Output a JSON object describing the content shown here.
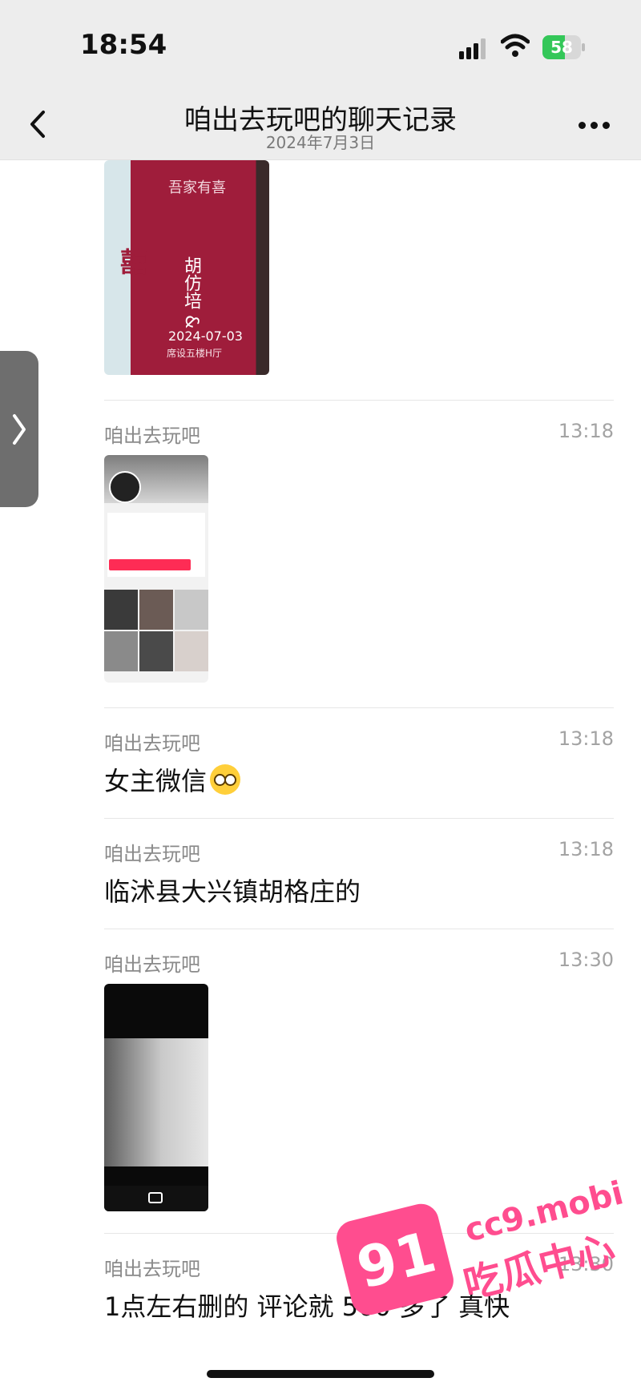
{
  "status_bar": {
    "time": "18:54",
    "battery_level": "58",
    "battery_fraction": 0.58,
    "battery_color": "#34c759"
  },
  "nav": {
    "title": "咱出去玩吧的聊天记录",
    "subtitle": "2024年7月3日",
    "back_icon": "chevron-left-icon",
    "more_icon": "ellipsis-icon"
  },
  "side_tab": {
    "icon": "chevron-right-icon"
  },
  "poster": {
    "xi": "囍",
    "title": "吾家有喜",
    "name": "胡仿培 &",
    "date": "2024-07-03",
    "venue": "席设五楼H厅"
  },
  "messages": [
    {
      "sender": "咱出去玩吧",
      "time": "13:18",
      "type": "image"
    },
    {
      "sender": "咱出去玩吧",
      "time": "13:18",
      "type": "text",
      "text": "女主微信"
    },
    {
      "sender": "咱出去玩吧",
      "time": "13:18",
      "type": "text",
      "text": "临沭县大兴镇胡格庄的"
    },
    {
      "sender": "咱出去玩吧",
      "time": "13:30",
      "type": "image"
    },
    {
      "sender": "咱出去玩吧",
      "time": "13:30",
      "type": "text",
      "text": "1点左右删的 评论就 500 多了 真快"
    }
  ],
  "watermark": {
    "badge": "91",
    "url": "cc9.mobi",
    "name": "吃瓜中心",
    "color": "#ff4d8f"
  }
}
